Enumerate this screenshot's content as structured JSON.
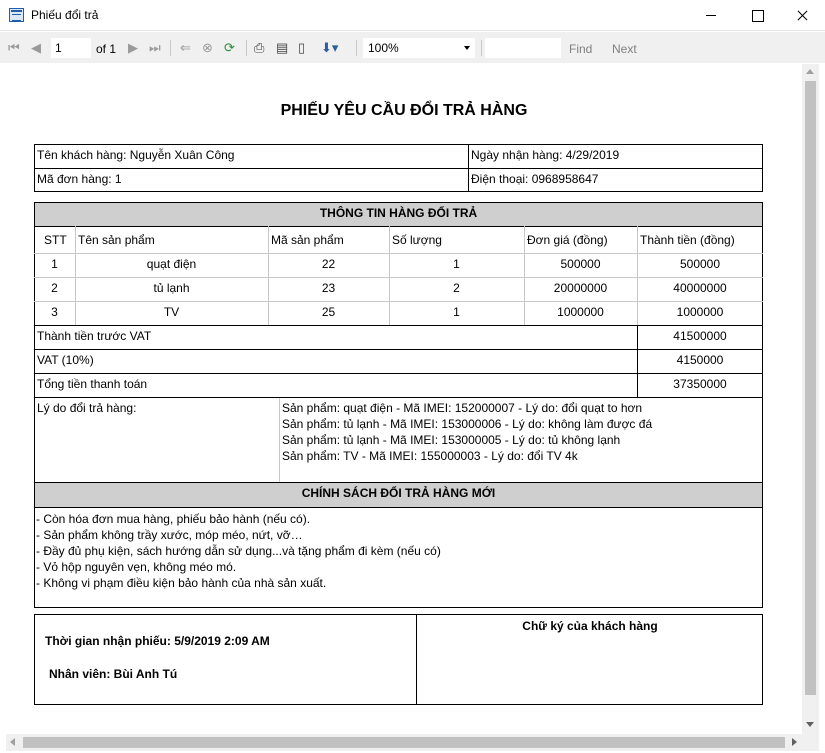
{
  "window": {
    "title": "Phiếu đổi trả"
  },
  "toolbar": {
    "page_current": "1",
    "page_of": "of 1",
    "zoom": "100%",
    "find_label": "Find",
    "next_label": "Next"
  },
  "report": {
    "title": "PHIẾU YÊU CẦU ĐỔI TRẢ HÀNG",
    "customer": "Tên khách hàng: Nguyễn Xuân Công",
    "received_date": "Ngày nhận hàng: 4/29/2019",
    "order_no": "Mã đơn hàng: 1",
    "phone": "Điện thoại: 0968958647",
    "items_section": "THÔNG TIN HÀNG ĐỔI TRẢ",
    "columns": [
      "STT",
      "Tên sản phẩm",
      "Mã sản phẩm",
      "Số lượng",
      "Đơn giá (đồng)",
      "Thành tiền (đồng)"
    ],
    "rows": [
      [
        "1",
        "quạt điện",
        "22",
        "1",
        "500000",
        "500000"
      ],
      [
        "2",
        "tủ lạnh",
        "23",
        "2",
        "20000000",
        "40000000"
      ],
      [
        "3",
        "TV",
        "25",
        "1",
        "1000000",
        "1000000"
      ]
    ],
    "subtotal_label": "Thành tiền trước VAT",
    "subtotal_value": "41500000",
    "vat_label": "VAT (10%)",
    "vat_value": "4150000",
    "total_label": "Tổng tiền thanh toán",
    "total_value": "37350000",
    "reason_label": "Lý do đổi trả hàng:",
    "reasons": [
      "Sản phẩm: quạt điện - Mã IMEI:  152000007      - Lý do:  đổi quạt to hơn",
      "Sản phẩm: tủ lạnh - Mã IMEI:  153000006 - Lý do:  không làm được đá",
      "Sản phẩm: tủ lạnh - Mã IMEI:  153000005 - Lý do:  tủ không lạnh",
      "Sản phẩm: TV - Mã IMEI:  155000003      - Lý do:  đổi TV 4k"
    ],
    "policy_section": "CHÍNH SÁCH ĐỔI TRẢ HÀNG MỚI",
    "policies": [
      "- Còn hóa đơn mua hàng, phiếu bảo hành (nếu có).",
      "- Sản phẩm không trầy xước, móp méo, nứt, vỡ…",
      "- Đầy đủ phụ kiện, sách hướng dẫn sử dụng...và tặng phẩm đi kèm (nếu có)",
      "- Vỏ hộp nguyên vẹn, không méo mó.",
      "- Không vi phạm điều kiện bảo hành của nhà sản xuất."
    ],
    "receipt_time": "Thời gian nhận phiếu: 5/9/2019 2:09 AM",
    "staff": "Nhân viên: Bùi Anh Tú",
    "signature_label": "Chữ ký của khách hàng"
  }
}
